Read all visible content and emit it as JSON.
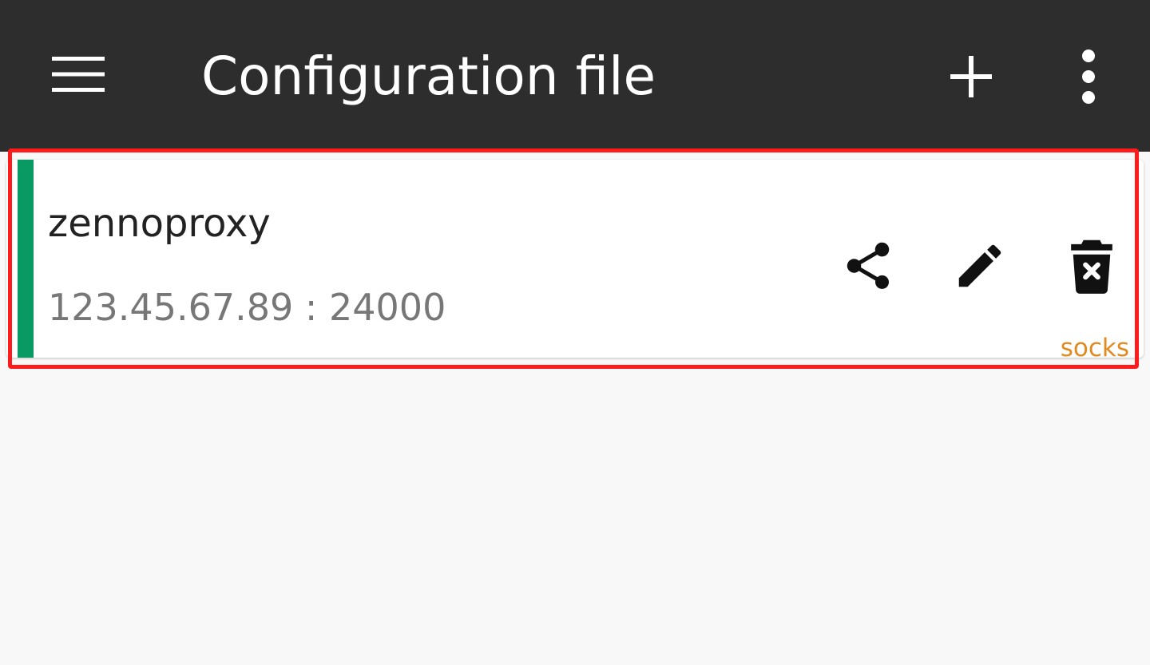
{
  "appbar": {
    "title": "Configuration file",
    "menu_icon": "hamburger-menu-icon",
    "add_icon": "plus-icon",
    "more_icon": "more-vertical-icon"
  },
  "profiles": [
    {
      "name": "zennoproxy",
      "address": "123.45.67.89 : 24000",
      "type": "socks",
      "status_color": "#089a62",
      "actions": {
        "share_icon": "share-icon",
        "edit_icon": "edit-icon",
        "delete_icon": "delete-icon"
      }
    }
  ],
  "colors": {
    "appbar": "#2d2d2d",
    "background": "#f8f8f8",
    "tag": "#e28a22",
    "highlight": "#ff1b1b"
  }
}
